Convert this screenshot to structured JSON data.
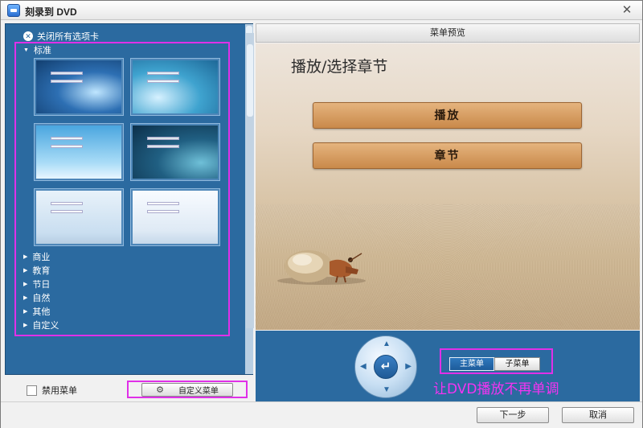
{
  "window": {
    "title": "刻录到 DVD",
    "close_symbol": "✕"
  },
  "left_panel": {
    "close_all_tabs": "关闭所有选项卡",
    "close_all_icon": "x-circle-icon",
    "categories": [
      {
        "label": "标准",
        "expanded": true
      },
      {
        "label": "商业",
        "expanded": false
      },
      {
        "label": "教育",
        "expanded": false
      },
      {
        "label": "节日",
        "expanded": false
      },
      {
        "label": "自然",
        "expanded": false
      },
      {
        "label": "其他",
        "expanded": false
      },
      {
        "label": "自定义",
        "expanded": false
      }
    ],
    "templates": [
      "template-1",
      "template-2",
      "template-3",
      "template-4",
      "template-5",
      "template-6"
    ]
  },
  "bottom_left": {
    "disable_menu_label": "禁用菜单",
    "disable_menu_checked": false,
    "custom_menu_label": "自定义菜单",
    "custom_menu_icon": "gear-icon"
  },
  "preview": {
    "header": "菜单预览",
    "title": "播放/选择章节",
    "play_label": "播放",
    "chapter_label": "章节"
  },
  "controls": {
    "enter_symbol": "↵",
    "tab_main": "主菜单",
    "tab_sub": "子菜单",
    "annotation": "让DVD播放不再单调",
    "annotation_color": "#f533f2"
  },
  "footer": {
    "next_label": "下一步",
    "cancel_label": "取消"
  },
  "colors": {
    "panel_blue": "#2b6aa0",
    "highlight_frame": "#e030e8",
    "button_orange": "#d49a5e"
  }
}
